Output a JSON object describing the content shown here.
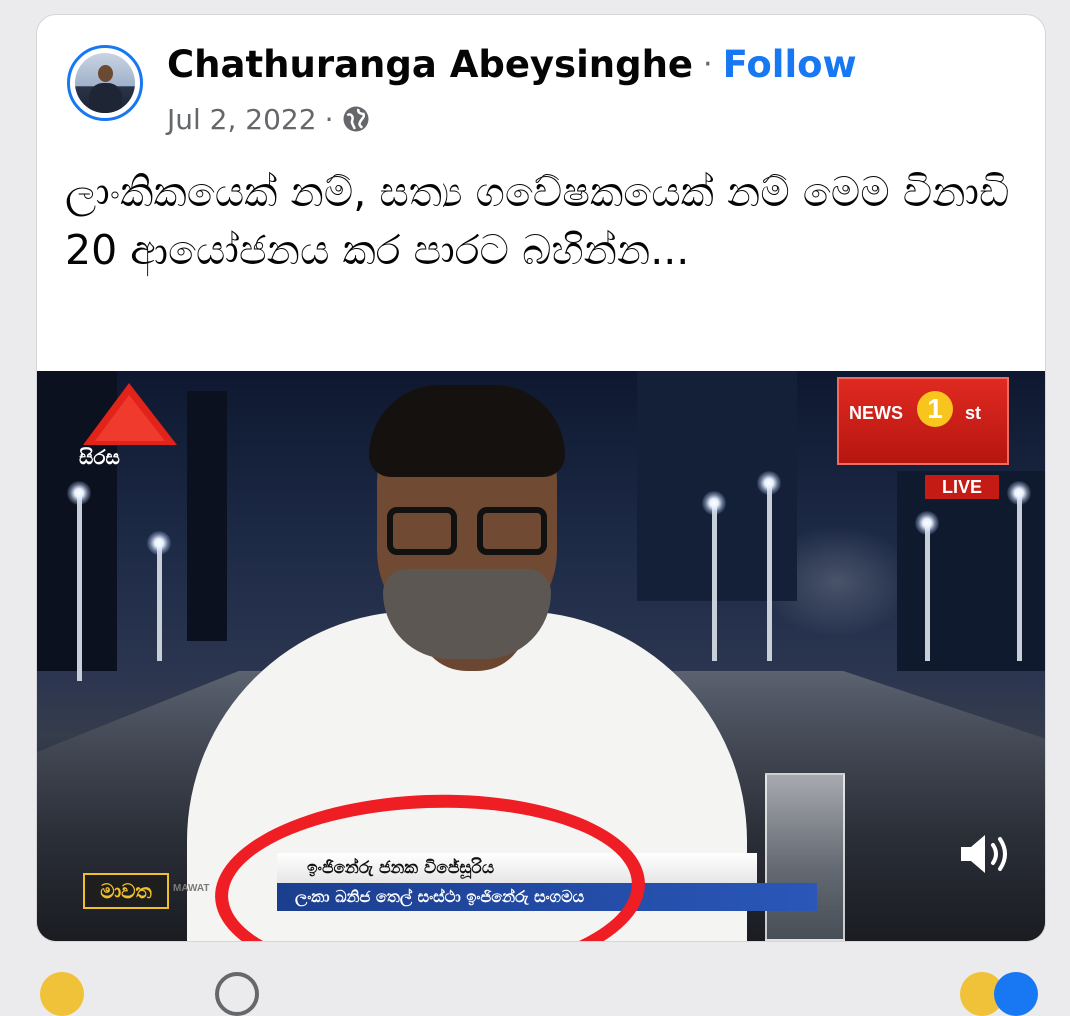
{
  "post": {
    "author": "Chathuranga Abeysinghe",
    "separator": "·",
    "follow_label": "Follow",
    "date": "Jul 2, 2022",
    "privacy_icon": "globe-icon",
    "caption": "ලාංකිකයෙක් නම්, සත්‍ය ගවේෂකයෙක් නම් මෙම විනාඩි 20 ආයෝජනය කර පාරට බහින්න..."
  },
  "video": {
    "channel_logo_text": "සිරස",
    "news_brand_left": "NEWS",
    "news_brand_number": "1",
    "news_brand_right": "st",
    "live_badge": "LIVE",
    "program_name": "මාවත",
    "program_sub": "MAWAT",
    "lower_third_name": "ඉංජිනේරු ජනක විජේසූරිය",
    "lower_third_title": "ලංකා ඛනිජ තෙල් සංස්ථා ඉංජිනේරු සංගමය",
    "mute_icon": "speaker-icon"
  },
  "colors": {
    "accent": "#1877f2",
    "annotation": "#ef1d24",
    "live": "#c41b14"
  }
}
